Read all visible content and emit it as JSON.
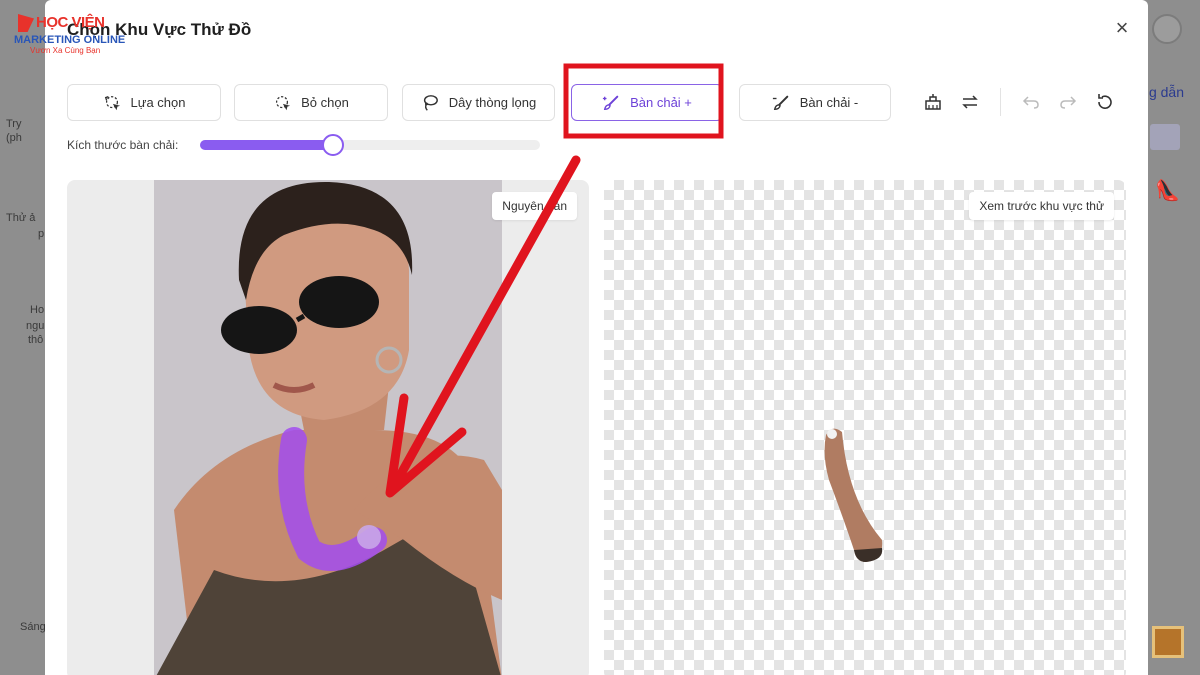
{
  "background": {
    "left_fragments": [
      "Try",
      "(ph",
      "Thử ả",
      "p",
      "Ho",
      "ngu",
      "thô",
      "Sáng"
    ],
    "right_link": "g dẫn"
  },
  "modal": {
    "title": "Chọn Khu Vực Thử Đồ",
    "close_label": "×"
  },
  "toolbar": {
    "tools": [
      {
        "label": "Lựa chọn",
        "icon": "lasso-select-icon"
      },
      {
        "label": "Bỏ chọn",
        "icon": "lasso-deselect-icon"
      },
      {
        "label": "Dây thòng lọng",
        "icon": "lasso-rope-icon"
      },
      {
        "label": "Bàn chải +",
        "icon": "brush-plus-icon",
        "active": true
      },
      {
        "label": "Bàn chải -",
        "icon": "brush-minus-icon"
      }
    ],
    "icons": [
      "eraser-icon",
      "swap-icon",
      "undo-icon",
      "redo-icon",
      "reset-icon"
    ]
  },
  "brush": {
    "label": "Kích thước bàn chải:",
    "size_fraction": 0.39
  },
  "panels": {
    "original_tag": "Nguyên bản",
    "preview_tag": "Xem trước khu vực thử"
  },
  "watermark": {
    "main": "HỌC VIỆN",
    "sub": "MARKETING ONLINE",
    "tagline": "Vươn Xa Cùng Bạn"
  },
  "colors": {
    "accent": "#8a5cf0",
    "annotation": "#e0141e",
    "brush_stroke": "#a24cf0"
  }
}
